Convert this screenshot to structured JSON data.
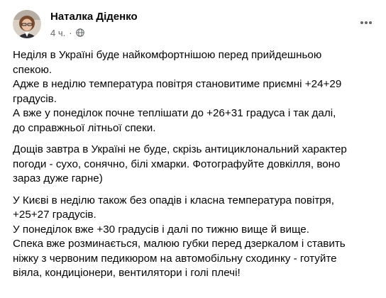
{
  "post": {
    "author_name": "Наталка Діденко",
    "timestamp": "4 ч.",
    "separator": "·",
    "visibility_icon": "globe-icon",
    "more_icon": "more-horizontal-icon",
    "avatar_icon": "user-avatar",
    "paragraphs": [
      "Неділя в Україні буде найкомфортнішою перед прийдешньою\nспекою.\nАдже в неділю температура повітря становитиме приємні +24+29\nградусів.\nА вже у понеділок почне теплішати до +26+31 градуса і так далі,\nдо справжньої літньої спеки.",
      "Дощів завтра в Україні не буде, скрізь антициклональний характер\nпогоди - сухо, сонячно, білі хмарки. Фотографуйте довкілля, воно\nзараз дуже гарне)",
      "У Києві в неділю також без опадів і класна температура повітря,\n+25+27 градусів.\nУ понеділок вже +30 градусів і далі по тижню вище й вище.\nСпека вже розминається, малюю губки перед дзеркалом і ставить\nніжку з червоним педикюром на автомобільну сходинку - готуйте\nвіяла, кондиціонери, вентилятори і голі плечі!"
    ]
  },
  "colors": {
    "text": "#050505",
    "secondary_text": "#65676b"
  }
}
